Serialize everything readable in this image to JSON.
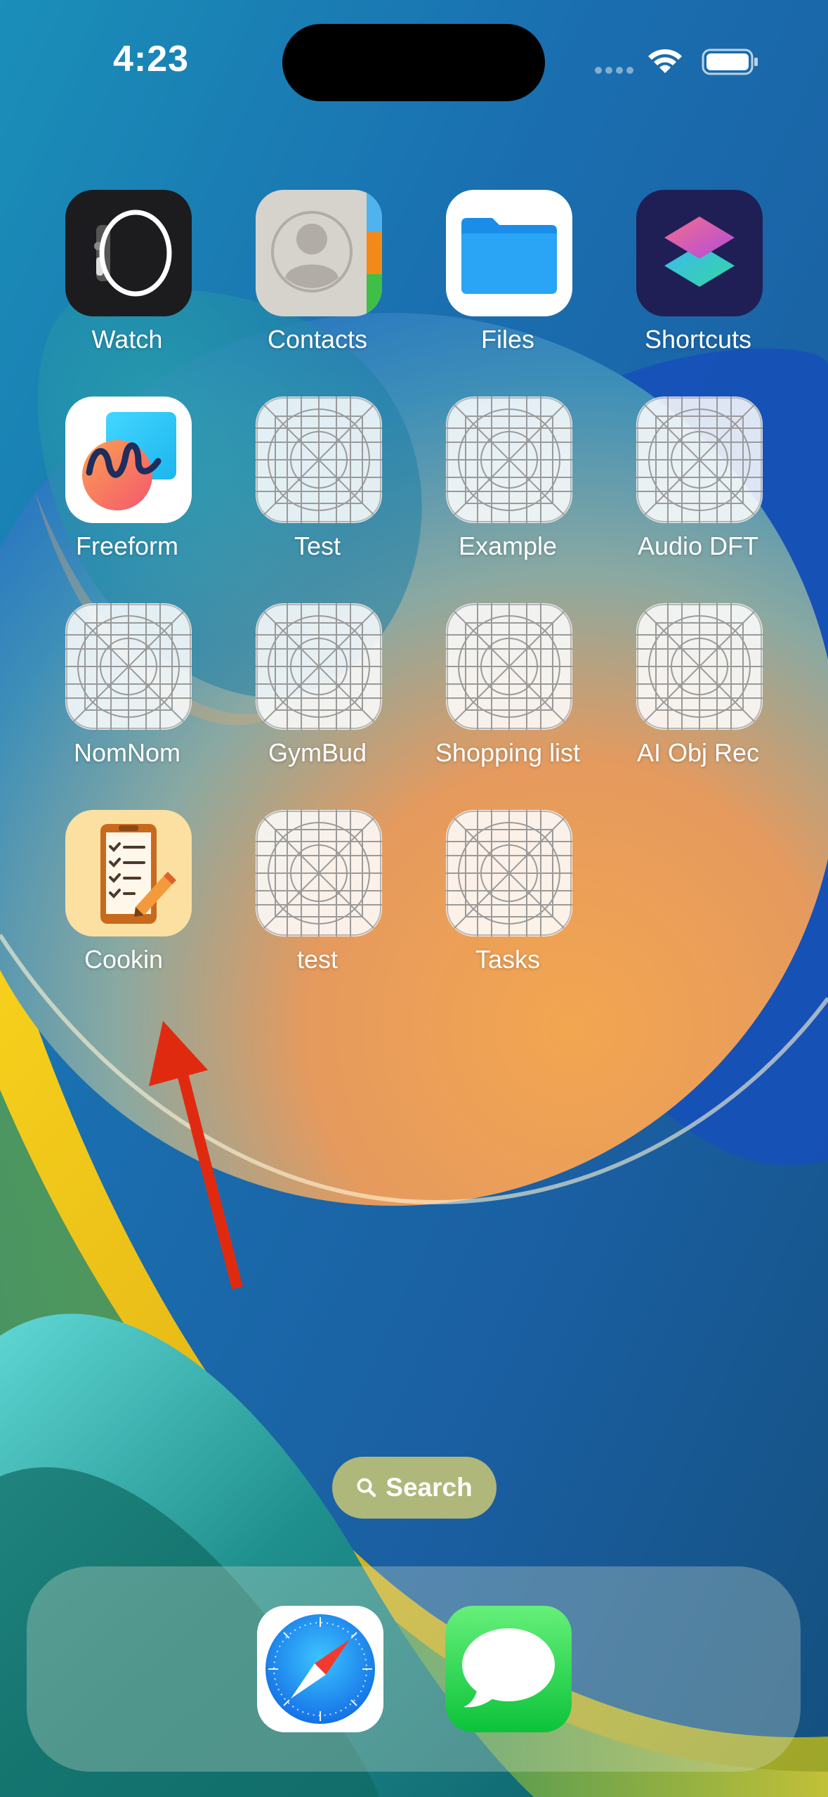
{
  "status_bar": {
    "time": "4:23",
    "signal_icon": "cellular-dots-icon",
    "wifi_icon": "wifi-icon",
    "battery_icon": "battery-full-icon"
  },
  "home_screen": {
    "rows": [
      [
        {
          "label": "Watch",
          "icon": "watch-app-icon"
        },
        {
          "label": "Contacts",
          "icon": "contacts-app-icon"
        },
        {
          "label": "Files",
          "icon": "files-app-icon"
        },
        {
          "label": "Shortcuts",
          "icon": "shortcuts-app-icon"
        }
      ],
      [
        {
          "label": "Freeform",
          "icon": "freeform-app-icon"
        },
        {
          "label": "Test",
          "icon": "placeholder-grid-icon"
        },
        {
          "label": "Example",
          "icon": "placeholder-grid-icon"
        },
        {
          "label": "Audio DFT",
          "icon": "placeholder-grid-icon"
        }
      ],
      [
        {
          "label": "NomNom",
          "icon": "placeholder-grid-icon"
        },
        {
          "label": "GymBud",
          "icon": "placeholder-grid-icon"
        },
        {
          "label": "Shopping list",
          "icon": "placeholder-grid-icon"
        },
        {
          "label": "AI Obj Rec",
          "icon": "placeholder-grid-icon"
        }
      ],
      [
        {
          "label": "Cookin",
          "icon": "cookin-checklist-app-icon"
        },
        {
          "label": "test",
          "icon": "placeholder-grid-icon"
        },
        {
          "label": "Tasks",
          "icon": "placeholder-grid-icon"
        }
      ]
    ]
  },
  "search": {
    "label": "Search",
    "icon": "search-icon"
  },
  "dock": {
    "apps": [
      {
        "name": "Safari",
        "icon": "safari-compass-icon"
      },
      {
        "name": "Messages",
        "icon": "messages-bubble-icon"
      }
    ]
  },
  "annotation": {
    "arrow_color": "#e02a10",
    "points_to": "Cookin"
  },
  "colors": {
    "wallpaper_blue": "#1e6fb5",
    "wallpaper_orange": "#f0a050",
    "wallpaper_yellow": "#f2c419",
    "wallpaper_teal": "#2a9a90"
  }
}
